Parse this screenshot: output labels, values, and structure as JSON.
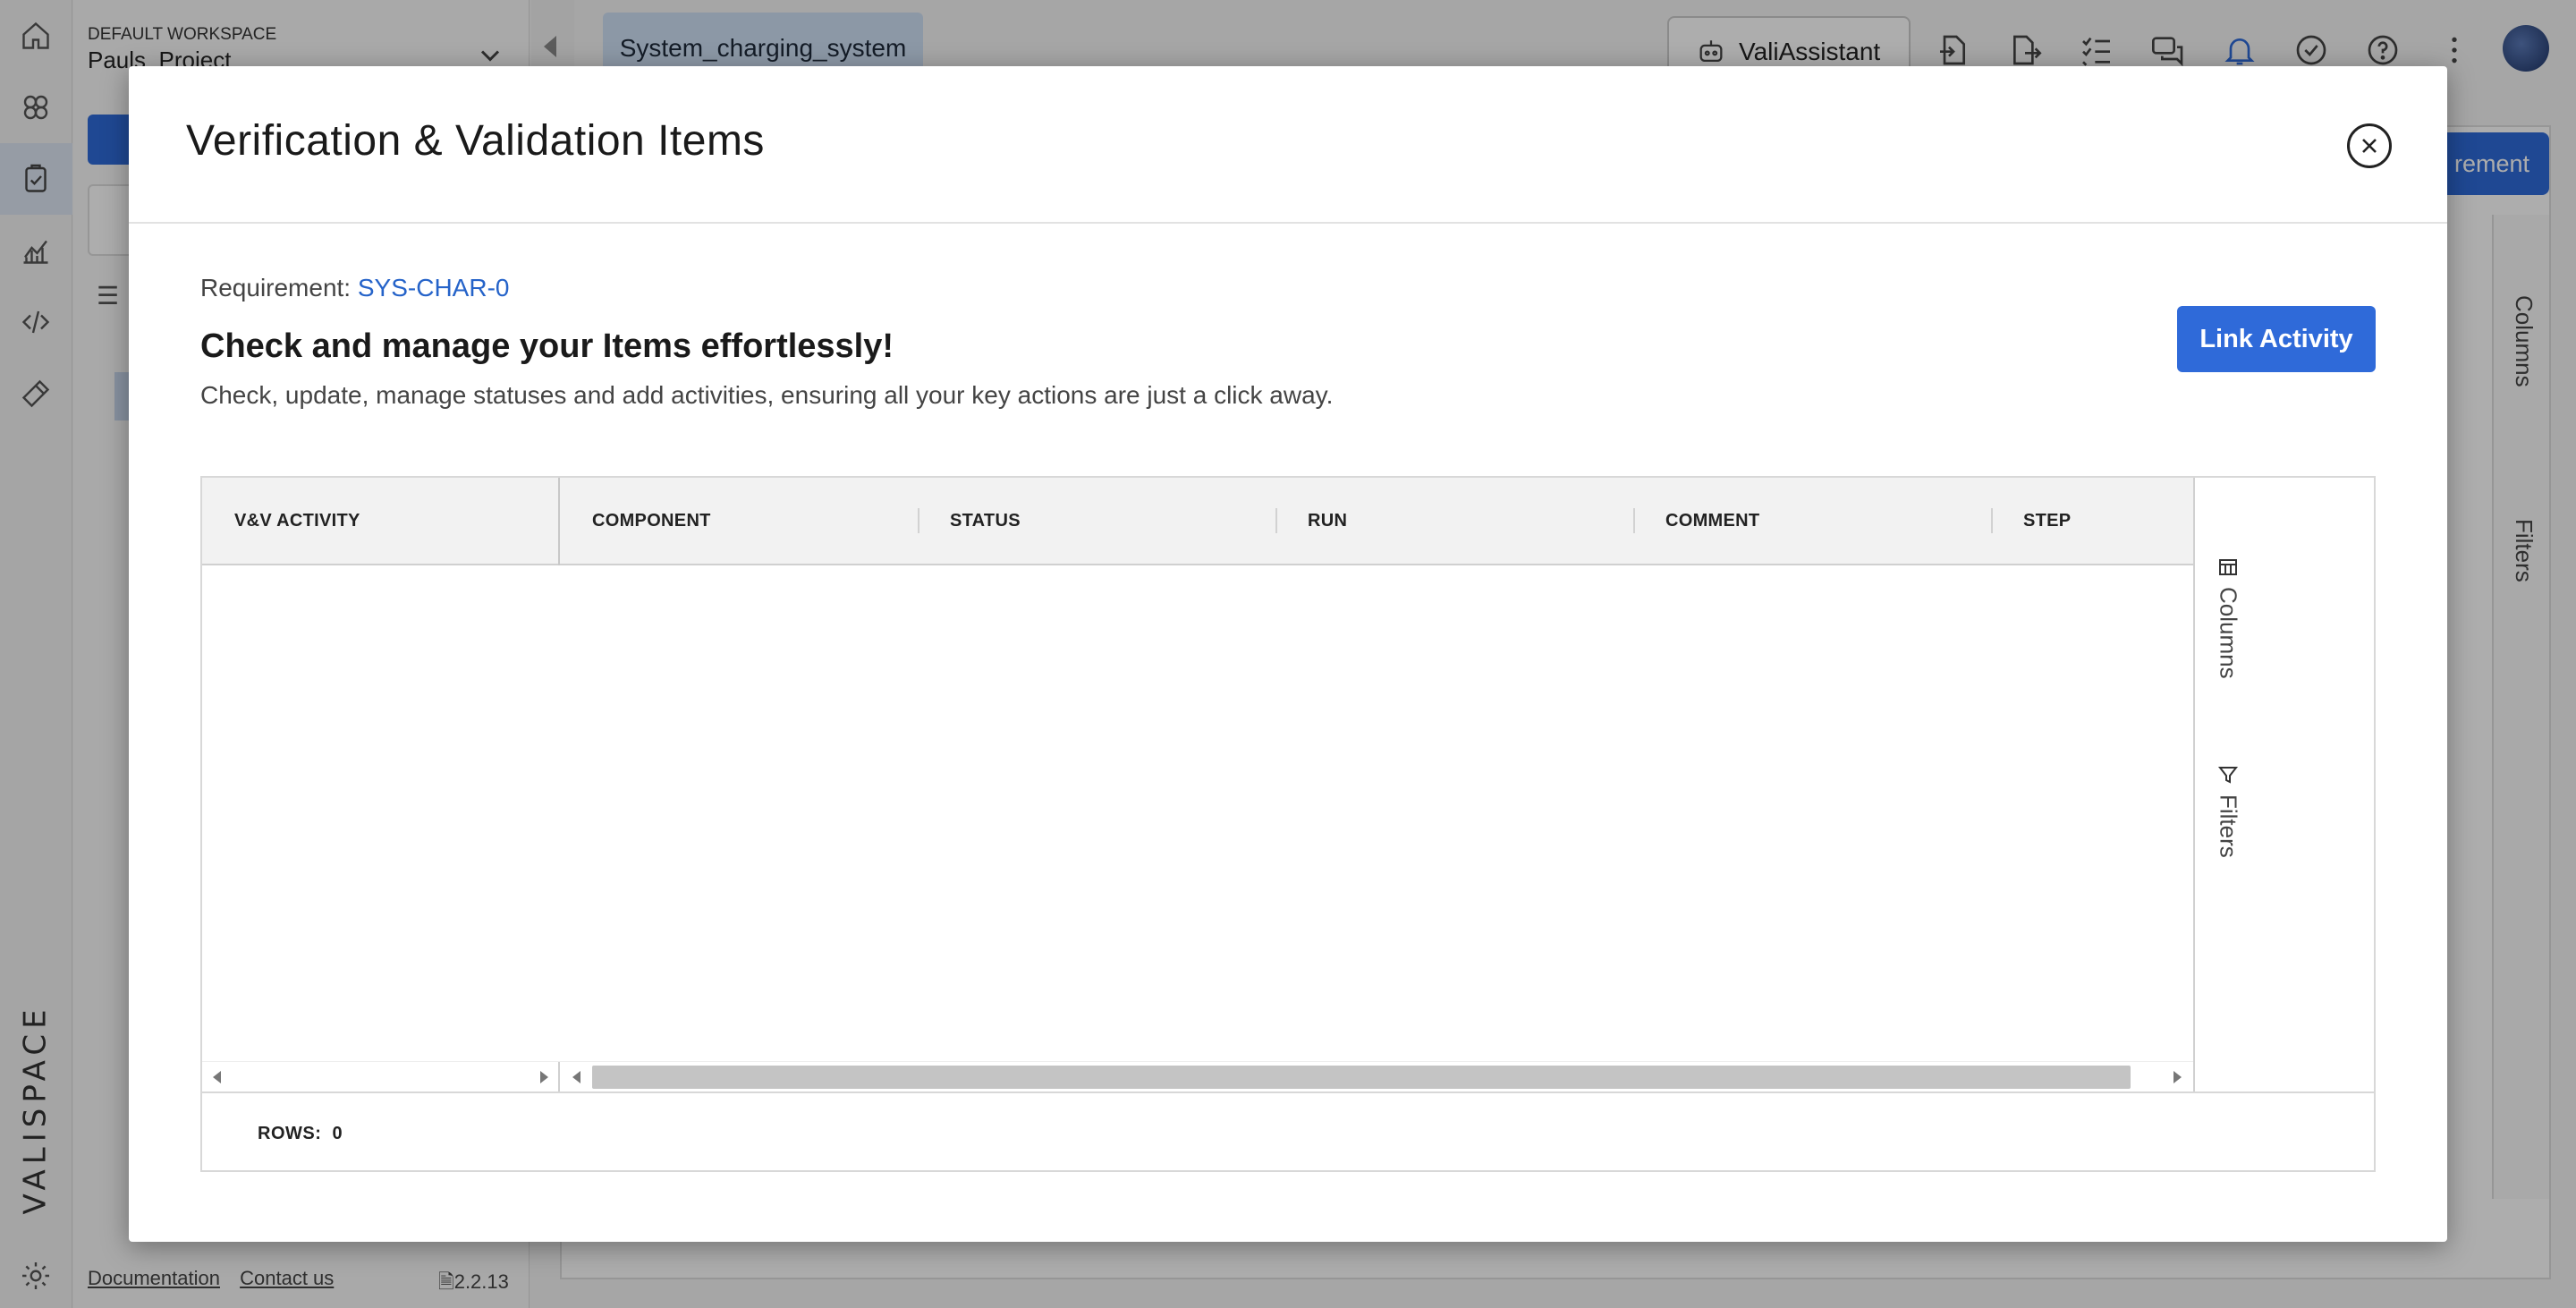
{
  "background": {
    "workspace_label": "DEFAULT WORKSPACE",
    "project_name": "Pauls_Project",
    "document_tab": "System_charging_system",
    "assistant_label": "ValiAssistant",
    "brand": "VALISPACE",
    "add_requirement_label": "rement",
    "side_columns": "Columns",
    "side_filters": "Filters",
    "footer": {
      "documentation": "Documentation",
      "contact": "Contact us",
      "version": "2.2.13"
    }
  },
  "modal": {
    "title": "Verification & Validation Items",
    "requirement_label": "Requirement:",
    "requirement_id": "SYS-CHAR-0",
    "headline": "Check and manage your Items effortlessly!",
    "subtext": "Check, update, manage statuses and add activities, ensuring all your key actions are just a click away.",
    "link_button": "Link Activity",
    "grid": {
      "columns": [
        "V&V ACTIVITY",
        "COMPONENT",
        "STATUS",
        "RUN",
        "COMMENT",
        "STEP"
      ],
      "side_columns": "Columns",
      "side_filters": "Filters",
      "rows_label": "ROWS:",
      "rows_count": "0"
    }
  },
  "colors": {
    "accent": "#2f6ad9",
    "link": "#2563c9",
    "overlay": "rgba(0,0,0,0.32)"
  }
}
